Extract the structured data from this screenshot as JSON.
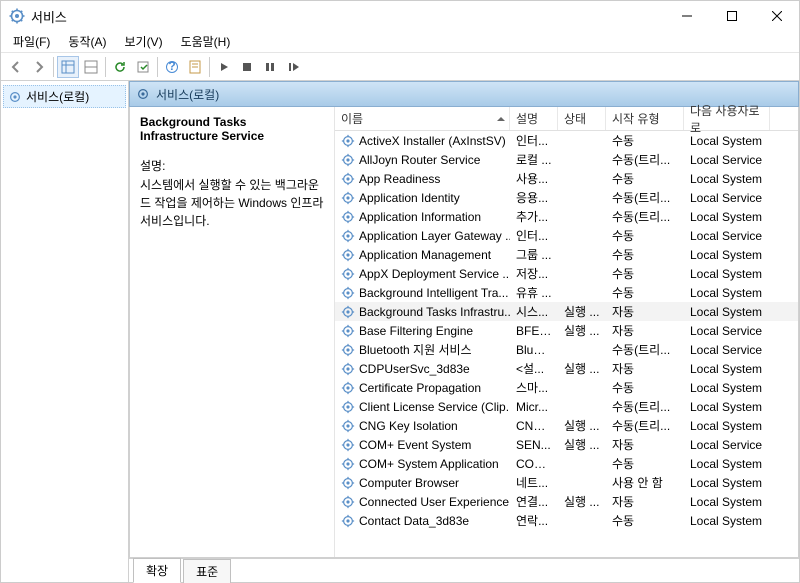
{
  "window": {
    "title": "서비스"
  },
  "menu": {
    "file": "파일(F)",
    "action": "동작(A)",
    "view": "보기(V)",
    "help": "도움말(H)"
  },
  "tree": {
    "root": "서비스(로컬)"
  },
  "content_header": "서비스(로컬)",
  "detail": {
    "title": "Background Tasks Infrastructure Service",
    "desc_label": "설명:",
    "desc": "시스템에서 실행할 수 있는 백그라운드 작업을 제어하는 Windows 인프라 서비스입니다."
  },
  "columns": {
    "name": "이름",
    "desc": "설명",
    "status": "상태",
    "start": "시작 유형",
    "logon": "다음 사용자로 로"
  },
  "services": [
    {
      "name": "ActiveX Installer (AxInstSV)",
      "desc": "인터...",
      "status": "",
      "start": "수동",
      "logon": "Local System"
    },
    {
      "name": "AllJoyn Router Service",
      "desc": "로컬 ...",
      "status": "",
      "start": "수동(트리...",
      "logon": "Local Service"
    },
    {
      "name": "App Readiness",
      "desc": "사용...",
      "status": "",
      "start": "수동",
      "logon": "Local System"
    },
    {
      "name": "Application Identity",
      "desc": "응용...",
      "status": "",
      "start": "수동(트리...",
      "logon": "Local Service"
    },
    {
      "name": "Application Information",
      "desc": "추가...",
      "status": "",
      "start": "수동(트리...",
      "logon": "Local System"
    },
    {
      "name": "Application Layer Gateway ...",
      "desc": "인터...",
      "status": "",
      "start": "수동",
      "logon": "Local Service"
    },
    {
      "name": "Application Management",
      "desc": "그룹 ...",
      "status": "",
      "start": "수동",
      "logon": "Local System"
    },
    {
      "name": "AppX Deployment Service ...",
      "desc": "저장...",
      "status": "",
      "start": "수동",
      "logon": "Local System"
    },
    {
      "name": "Background Intelligent Tra...",
      "desc": "유휴 ...",
      "status": "",
      "start": "수동",
      "logon": "Local System"
    },
    {
      "name": "Background Tasks Infrastru...",
      "desc": "시스...",
      "status": "실행 ...",
      "start": "자동",
      "logon": "Local System",
      "selected": true
    },
    {
      "name": "Base Filtering Engine",
      "desc": "BFE(...",
      "status": "실행 ...",
      "start": "자동",
      "logon": "Local Service"
    },
    {
      "name": "Bluetooth 지원 서비스",
      "desc": "Bluet...",
      "status": "",
      "start": "수동(트리...",
      "logon": "Local Service"
    },
    {
      "name": "CDPUserSvc_3d83e",
      "desc": "<설...",
      "status": "실행 ...",
      "start": "자동",
      "logon": "Local System"
    },
    {
      "name": "Certificate Propagation",
      "desc": "스마...",
      "status": "",
      "start": "수동",
      "logon": "Local System"
    },
    {
      "name": "Client License Service (Clip...",
      "desc": "Micr...",
      "status": "",
      "start": "수동(트리...",
      "logon": "Local System"
    },
    {
      "name": "CNG Key Isolation",
      "desc": "CNG ...",
      "status": "실행 ...",
      "start": "수동(트리...",
      "logon": "Local System"
    },
    {
      "name": "COM+ Event System",
      "desc": "SEN...",
      "status": "실행 ...",
      "start": "자동",
      "logon": "Local Service"
    },
    {
      "name": "COM+ System Application",
      "desc": "COM...",
      "status": "",
      "start": "수동",
      "logon": "Local System"
    },
    {
      "name": "Computer Browser",
      "desc": "네트...",
      "status": "",
      "start": "사용 안 함",
      "logon": "Local System"
    },
    {
      "name": "Connected User Experience...",
      "desc": "연결...",
      "status": "실행 ...",
      "start": "자동",
      "logon": "Local System"
    },
    {
      "name": "Contact Data_3d83e",
      "desc": "연락...",
      "status": "",
      "start": "수동",
      "logon": "Local System"
    }
  ],
  "tabs": {
    "extended": "확장",
    "standard": "표준"
  }
}
